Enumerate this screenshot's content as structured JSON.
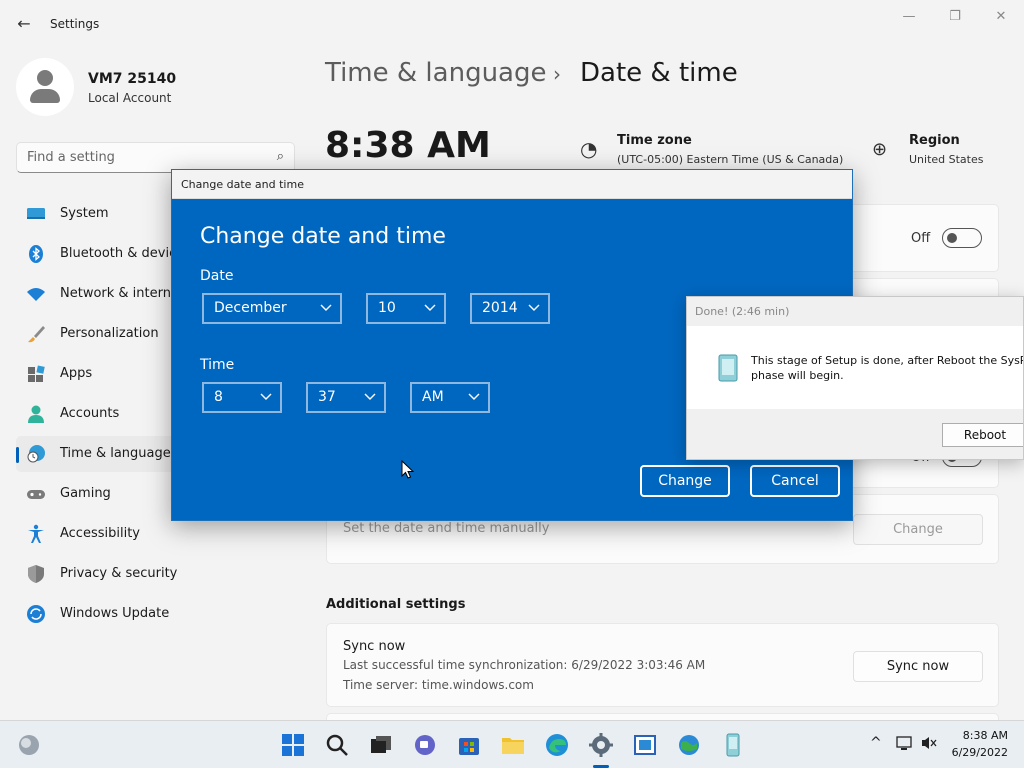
{
  "window": {
    "title": "Settings",
    "back": "←",
    "minimize": "—",
    "restore": "❐",
    "close": "✕"
  },
  "account": {
    "name": "VM7 25140",
    "type": "Local Account"
  },
  "search": {
    "placeholder": "Find a setting",
    "icon": "⌕"
  },
  "nav": [
    {
      "label": "System",
      "icon": "monitor-icon"
    },
    {
      "label": "Bluetooth & devices",
      "icon": "bluetooth-icon"
    },
    {
      "label": "Network & internet",
      "icon": "wifi-icon"
    },
    {
      "label": "Personalization",
      "icon": "brush-icon"
    },
    {
      "label": "Apps",
      "icon": "apps-icon"
    },
    {
      "label": "Accounts",
      "icon": "person-icon"
    },
    {
      "label": "Time & language",
      "icon": "clock-globe-icon",
      "active": true
    },
    {
      "label": "Gaming",
      "icon": "gamepad-icon"
    },
    {
      "label": "Accessibility",
      "icon": "accessibility-icon"
    },
    {
      "label": "Privacy & security",
      "icon": "shield-icon"
    },
    {
      "label": "Windows Update",
      "icon": "update-icon"
    }
  ],
  "header": {
    "parent": "Time & language",
    "separator": "›",
    "current": "Date & time"
  },
  "summary": {
    "time": "8:38 AM",
    "timezone_label": "Time zone",
    "timezone_value": "(UTC-05:00) Eastern Time (US & Canada)",
    "region_label": "Region",
    "region_value": "United States"
  },
  "settings": {
    "toggle1_state": "Off",
    "toggle2_state": "Off",
    "manual_text": "Set the date and time manually",
    "manual_button": "Change"
  },
  "additional": {
    "heading": "Additional settings",
    "sync_title": "Sync now",
    "sync_last": "Last successful time synchronization: 6/29/2022 3:03:46 AM",
    "sync_server": "Time server: time.windows.com",
    "sync_button": "Sync now"
  },
  "dialog": {
    "window_title": "Change date and time",
    "heading": "Change date and time",
    "date_label": "Date",
    "month": "December",
    "day": "10",
    "year": "2014",
    "time_label": "Time",
    "hour": "8",
    "minute": "37",
    "ampm": "AM",
    "change_button": "Change",
    "cancel_button": "Cancel"
  },
  "popup": {
    "title": "Done! (2:46 min)",
    "message": "This stage of Setup is done, after Reboot the SysPrep phase will begin.",
    "button": "Reboot"
  },
  "taskbar": {
    "clock_time": "8:38 AM",
    "clock_date": "6/29/2022",
    "tray_chevron": "^"
  },
  "colors": {
    "accent": "#005fb8",
    "dialog_blue": "#0067c0"
  }
}
